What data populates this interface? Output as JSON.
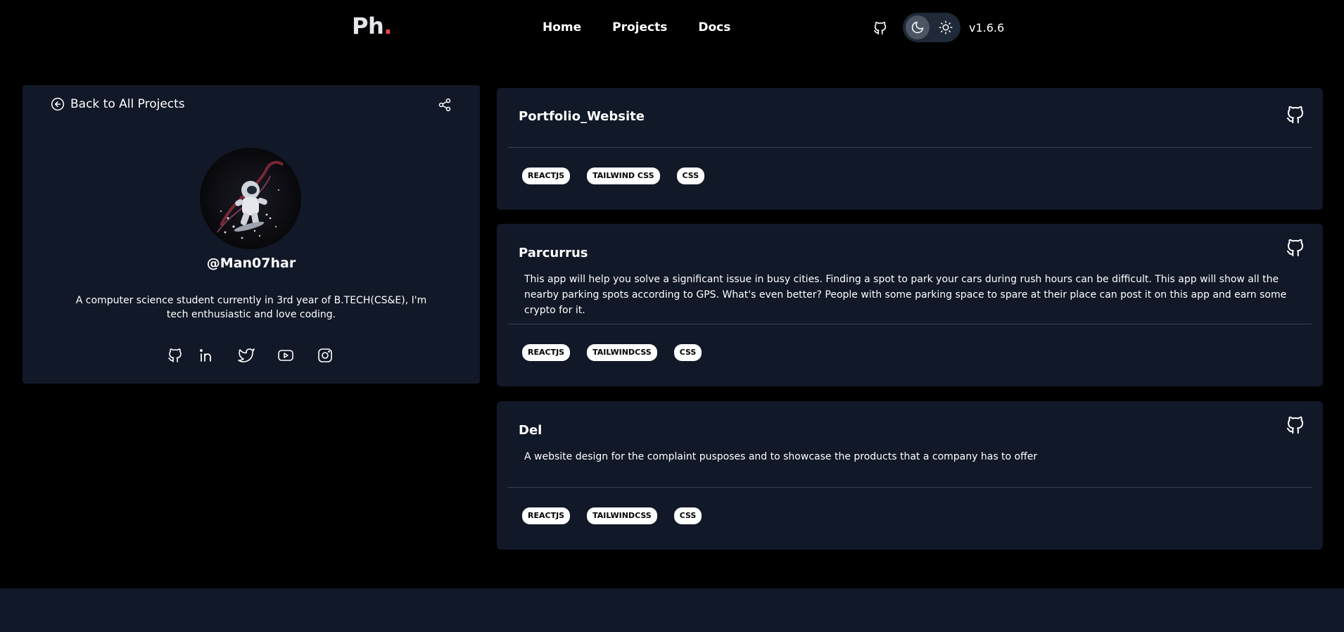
{
  "header": {
    "logo_main": "Ph",
    "logo_dot": ".",
    "nav": [
      "Home",
      "Projects",
      "Docs"
    ],
    "version": "v1.6.6",
    "icons": {
      "github": "github-icon",
      "moon": "moon-icon",
      "sun": "sun-icon"
    }
  },
  "profile": {
    "back_label": "Back to All Projects",
    "username": "@Man07har",
    "bio": "A computer science student currently in 3rd year of B.TECH(CS&E), I'm tech enthusiastic and love coding.",
    "socials": [
      "github-icon",
      "linkedin-icon",
      "twitter-icon",
      "youtube-icon",
      "instagram-icon"
    ]
  },
  "projects": [
    {
      "title": "Portfolio_Website",
      "description": "",
      "tags": [
        "REACTJS",
        "TAILWIND CSS",
        "CSS"
      ]
    },
    {
      "title": "Parcurrus",
      "description": "This app will help you solve a significant issue in busy cities. Finding a spot to park your cars during rush hours can be difficult. This app will show all the nearby parking spots according to GPS. What's even better? People with some parking space to spare at their place can post it on this app and earn some crypto for it.",
      "tags": [
        "REACTJS",
        "TAILWINDCSS",
        "CSS"
      ]
    },
    {
      "title": "Del",
      "description": "A website design for the complaint pusposes and to showcase the products that a company has to offer",
      "tags": [
        "REACTJS",
        "TAILWINDCSS",
        "CSS"
      ]
    }
  ],
  "colors": {
    "background": "#000000",
    "card": "#111827",
    "accent_dot": "#ef4444",
    "tag_bg": "#ffffff"
  }
}
